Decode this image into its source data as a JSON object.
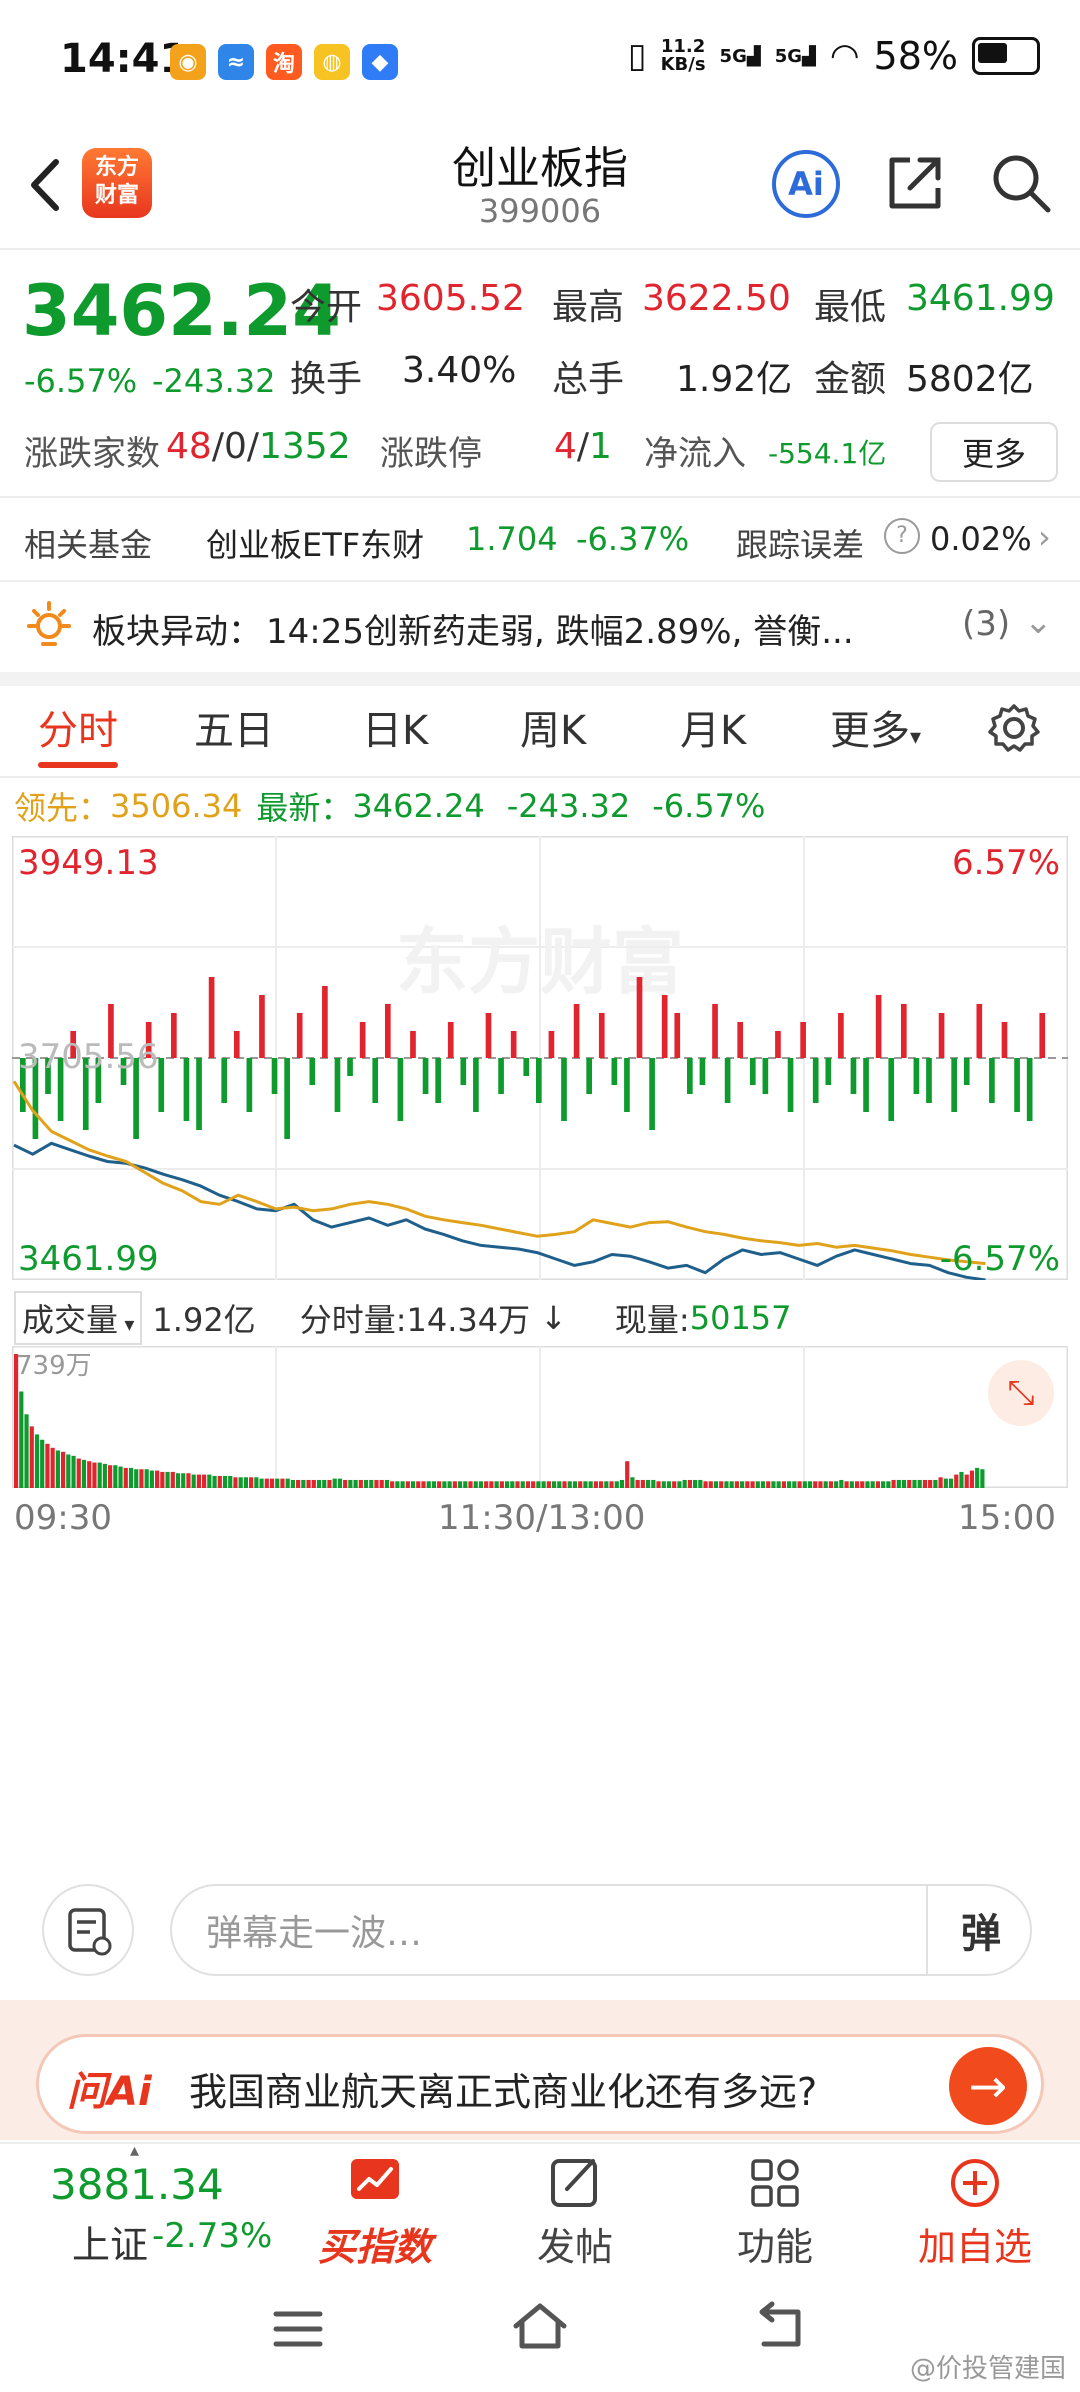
{
  "status": {
    "time": "14:41",
    "net_speed_value": "11.2",
    "net_speed_unit": "KB/s",
    "signal_1": "5G",
    "signal_2": "5G",
    "battery": "58%",
    "battery_level": 0.58,
    "app_icons": [
      "weibo-icon",
      "map-icon",
      "taobao-icon",
      "app-yellow-icon",
      "app-blue-icon"
    ]
  },
  "header": {
    "logo_text_1": "东方",
    "logo_text_2": "财富",
    "title": "创业板指",
    "code": "399006",
    "ai_label": "Ai"
  },
  "quote": {
    "price": "3462.24",
    "change_pct": "-6.57%",
    "change_amt": "-243.32",
    "open_label": "今开",
    "open": "3605.52",
    "high_label": "最高",
    "high": "3622.50",
    "low_label": "最低",
    "low": "3461.99",
    "turnover_label": "换手",
    "turnover": "3.40%",
    "volume_label": "总手",
    "volume": "1.92亿",
    "amount_label": "金额",
    "amount": "5802亿",
    "breadth_label": "涨跌家数",
    "breadth_up": "48",
    "breadth_flat": "0",
    "breadth_down": "1352",
    "slash": "/",
    "limit_label": "涨跌停",
    "limit_up": "4",
    "limit_down": "1",
    "netflow_label": "净流入",
    "netflow": "-554.1亿",
    "more_label": "更多"
  },
  "fund": {
    "label": "相关基金",
    "name": "创业板ETF东财",
    "price": "1.704",
    "change": "-6.37%",
    "tracking_label": "跟踪误差",
    "tracking_value": "0.02%"
  },
  "alert": {
    "label": "板块异动：",
    "text": "14:25创新药走弱, 跌幅2.89%, 誉衡...",
    "count": "(3)"
  },
  "tabs": [
    {
      "label": "分时"
    },
    {
      "label": "五日"
    },
    {
      "label": "日K"
    },
    {
      "label": "周K"
    },
    {
      "label": "月K"
    },
    {
      "label": "更多"
    }
  ],
  "info_line": {
    "lead_label": "领先：",
    "lead_value": "3506.34",
    "latest_label": "最新：",
    "latest_value": "3462.24",
    "change_amt": "-243.32",
    "change_pct": "-6.57%"
  },
  "chart_data": {
    "type": "line",
    "top_left_label": "3949.13",
    "top_right_label": "6.57%",
    "mid_label": "3705.56",
    "bottom_left_label": "3461.99",
    "bottom_right_label": "-6.57%",
    "watermark": "东方财富",
    "ylim": [
      3461.99,
      3949.13
    ],
    "prev_close": 3705.56,
    "x_labels": [
      "09:30",
      "11:30/13:00",
      "15:00"
    ],
    "series": [
      {
        "color": "#1f5f8b",
        "values": [
          3610,
          3600,
          3612,
          3605,
          3598,
          3592,
          3590,
          3585,
          3578,
          3572,
          3565,
          3555,
          3548,
          3540,
          3538,
          3545,
          3528,
          3520,
          3525,
          3530,
          3522,
          3528,
          3518,
          3512,
          3505,
          3500,
          3498,
          3496,
          3492,
          3485,
          3478,
          3482,
          3490,
          3488,
          3482,
          3475,
          3478,
          3470,
          3485,
          3495,
          3490,
          3492,
          3485,
          3478,
          3488,
          3495,
          3490,
          3485,
          3480,
          3478,
          3470,
          3465,
          3462
        ]
      },
      {
        "color": "#e0a21a",
        "values": [
          3680,
          3648,
          3625,
          3615,
          3605,
          3598,
          3592,
          3580,
          3568,
          3560,
          3548,
          3545,
          3555,
          3548,
          3540,
          3542,
          3538,
          3540,
          3545,
          3548,
          3545,
          3540,
          3532,
          3528,
          3525,
          3522,
          3518,
          3514,
          3510,
          3512,
          3515,
          3528,
          3524,
          3520,
          3525,
          3526,
          3520,
          3515,
          3512,
          3508,
          3505,
          3503,
          3500,
          3502,
          3498,
          3500,
          3497,
          3494,
          3490,
          3487,
          3484,
          3482,
          3480
        ]
      }
    ],
    "net_bars": [
      -0.6,
      -0.9,
      -0.4,
      -0.7,
      0.3,
      -0.8,
      -0.5,
      0.6,
      -0.3,
      -0.9,
      0.4,
      -0.6,
      0.5,
      -0.7,
      -0.8,
      0.9,
      -0.5,
      0.3,
      -0.6,
      0.7,
      -0.4,
      -0.9,
      0.5,
      -0.3,
      0.8,
      -0.6,
      -0.2,
      0.4,
      -0.5,
      0.6,
      -0.7,
      0.3,
      -0.4,
      -0.5,
      0.4,
      -0.3,
      -0.6,
      0.5,
      -0.4,
      0.3,
      -0.2,
      -0.5,
      0.3,
      -0.7,
      0.6,
      -0.4,
      0.5,
      -0.3,
      -0.6,
      0.9,
      -0.8,
      0.7,
      0.5,
      -0.4,
      -0.3,
      0.6,
      -0.5,
      0.4,
      -0.3,
      -0.4,
      0.3,
      -0.6,
      0.4,
      -0.5,
      -0.3,
      0.5,
      -0.4,
      -0.6,
      0.7,
      -0.7,
      0.6,
      -0.4,
      -0.5,
      0.5,
      -0.6,
      -0.3,
      0.6,
      -0.5,
      0.4,
      -0.6,
      -0.7,
      0.5
    ]
  },
  "volume": {
    "label": "成交量",
    "total": "1.92亿",
    "minute_label": "分时量:",
    "minute_value": "14.34万",
    "minute_arrow": "↓",
    "current_label": "现量:",
    "current_value": "50157",
    "max_label": "739万",
    "bars": [
      1.0,
      0.72,
      0.55,
      0.46,
      0.4,
      0.36,
      0.33,
      0.3,
      0.28,
      0.27,
      0.25,
      0.24,
      0.22,
      0.21,
      0.2,
      0.19,
      0.19,
      0.18,
      0.17,
      0.17,
      0.16,
      0.15,
      0.15,
      0.14,
      0.14,
      0.14,
      0.13,
      0.13,
      0.12,
      0.12,
      0.12,
      0.11,
      0.11,
      0.11,
      0.1,
      0.1,
      0.1,
      0.1,
      0.09,
      0.09,
      0.09,
      0.09,
      0.08,
      0.08,
      0.08,
      0.08,
      0.08,
      0.07,
      0.07,
      0.07,
      0.07,
      0.07,
      0.07,
      0.06,
      0.06,
      0.06,
      0.06,
      0.06,
      0.06,
      0.06,
      0.06,
      0.07,
      0.07,
      0.06,
      0.06,
      0.06,
      0.06,
      0.06,
      0.06,
      0.06,
      0.06,
      0.06,
      0.05,
      0.05,
      0.05,
      0.05,
      0.05,
      0.05,
      0.05,
      0.05,
      0.05,
      0.05,
      0.05,
      0.05,
      0.05,
      0.05,
      0.05,
      0.05,
      0.05,
      0.05,
      0.05,
      0.05,
      0.05,
      0.05,
      0.05,
      0.05,
      0.05,
      0.05,
      0.05,
      0.05,
      0.05,
      0.05,
      0.05,
      0.05,
      0.05,
      0.05,
      0.05,
      0.05,
      0.05,
      0.05,
      0.05,
      0.05,
      0.05,
      0.05,
      0.05,
      0.05,
      0.06,
      0.2,
      0.08,
      0.06,
      0.06,
      0.06,
      0.06,
      0.05,
      0.05,
      0.05,
      0.05,
      0.05,
      0.06,
      0.06,
      0.06,
      0.06,
      0.05,
      0.05,
      0.05,
      0.05,
      0.05,
      0.05,
      0.05,
      0.05,
      0.05,
      0.05,
      0.05,
      0.05,
      0.05,
      0.05,
      0.05,
      0.05,
      0.05,
      0.05,
      0.05,
      0.05,
      0.05,
      0.05,
      0.05,
      0.05,
      0.05,
      0.05,
      0.06,
      0.05,
      0.05,
      0.05,
      0.05,
      0.05,
      0.05,
      0.05,
      0.05,
      0.05,
      0.06,
      0.06,
      0.06,
      0.06,
      0.06,
      0.06,
      0.06,
      0.06,
      0.06,
      0.08,
      0.07,
      0.07,
      0.1,
      0.12,
      0.1,
      0.13,
      0.15,
      0.14
    ]
  },
  "danmaku": {
    "placeholder": "弹幕走一波…",
    "button": "弹"
  },
  "ai_banner": {
    "logo": "问Ai",
    "question": "我国商业航天离正式商业化还有多远?",
    "go": "→"
  },
  "bottom_bar": {
    "index_value": "3881.34",
    "index_name": "上证",
    "index_change": "-2.73%",
    "items": [
      {
        "label": "买指数"
      },
      {
        "label": "发帖"
      },
      {
        "label": "功能"
      },
      {
        "label": "加自选"
      }
    ]
  },
  "watermark": "@价投管建国",
  "colors": {
    "up": "#e0252e",
    "down": "#0f9a2e",
    "accent": "#e8361e",
    "line_price": "#1f5f8b",
    "line_avg": "#e0a21a"
  }
}
